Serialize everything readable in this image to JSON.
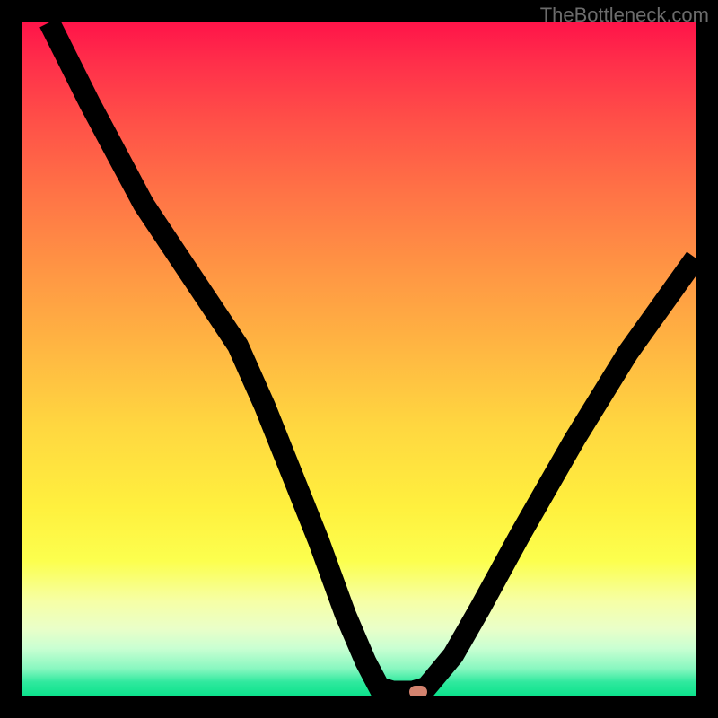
{
  "watermark": "TheBottleneck.com",
  "chart_data": {
    "type": "line",
    "title": "",
    "xlabel": "",
    "ylabel": "",
    "xlim": [
      0,
      100
    ],
    "ylim": [
      0,
      100
    ],
    "grid": false,
    "series": [
      {
        "name": "curve",
        "color": "#000000",
        "points": [
          {
            "x": 4.0,
            "y": 100
          },
          {
            "x": 10.0,
            "y": 88
          },
          {
            "x": 18.0,
            "y": 73
          },
          {
            "x": 24.0,
            "y": 64
          },
          {
            "x": 28.0,
            "y": 58
          },
          {
            "x": 32.0,
            "y": 52
          },
          {
            "x": 36.0,
            "y": 43
          },
          {
            "x": 40.0,
            "y": 33
          },
          {
            "x": 44.0,
            "y": 23
          },
          {
            "x": 48.0,
            "y": 12
          },
          {
            "x": 51.0,
            "y": 5
          },
          {
            "x": 53.0,
            "y": 1.2
          },
          {
            "x": 55.0,
            "y": 0.6
          },
          {
            "x": 58.0,
            "y": 0.6
          },
          {
            "x": 60.0,
            "y": 1.2
          },
          {
            "x": 64.0,
            "y": 6
          },
          {
            "x": 68.0,
            "y": 13
          },
          {
            "x": 74.0,
            "y": 24
          },
          {
            "x": 82.0,
            "y": 38
          },
          {
            "x": 90.0,
            "y": 51
          },
          {
            "x": 100.0,
            "y": 65
          }
        ]
      }
    ],
    "marker": {
      "x": 58.8,
      "y": 0.6,
      "color": "#d4836f"
    }
  }
}
